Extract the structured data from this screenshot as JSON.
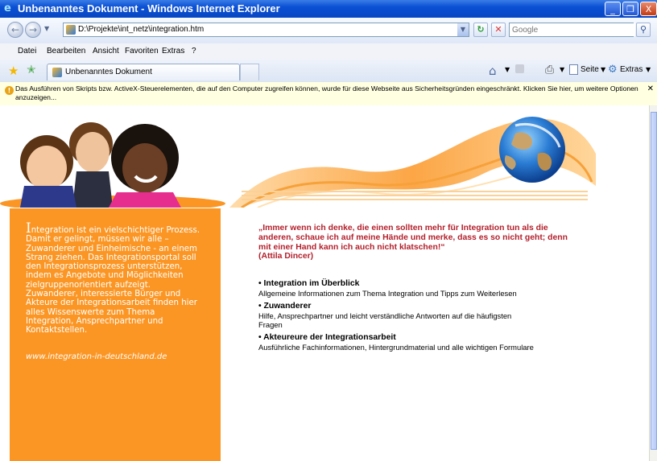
{
  "window": {
    "title": "Unbenanntes Dokument - Windows Internet Explorer",
    "minimize": "_",
    "maximize": "❐",
    "close": "X"
  },
  "address": {
    "url": "D:\\Projekte\\int_netz\\integration.htm",
    "search_placeholder": "Google"
  },
  "menu": {
    "items": [
      "Datei",
      "Bearbeiten",
      "Ansicht",
      "Favoriten",
      "Extras",
      "?"
    ]
  },
  "tabs": {
    "active_label": "Unbenanntes Dokument"
  },
  "commandbar": {
    "page_label": "Seite",
    "tools_label": "Extras"
  },
  "infobar": {
    "message": "Das Ausführen von Skripts bzw. ActiveX-Steuerelementen, die auf den Computer zugreifen können, wurde für diese Webseite aus Sicherheitsgründen eingeschränkt. Klicken Sie hier, um weitere Optionen anzuzeigen..."
  },
  "page": {
    "intro_initial": "I",
    "intro_text": "ntegration ist ein vielschichtiger Prozess. Damit er gelingt, müssen wir alle – Zuwanderer und Einheimische - an einem Strang ziehen. Das Integrationsportal soll den Integrationsprozess unterstützen, indem es Angebote und Möglichkeiten zielgruppenorientiert aufzeigt. Zuwanderer, interessierte Bürger und Akteure der Integrationsarbeit finden hier alles Wissenswerte zum Thema Integration, Ansprechpartner und Kontaktstellen.",
    "site_url": "www.integration-in-deutschland.de",
    "quote": "„Immer wenn ich denke, die einen sollten mehr für Integration tun als die anderen, schaue ich auf meine Hände und merke, dass es so nicht geht; denn mit einer Hand kann ich auch nicht klatschen!“",
    "quote_author": "(Attila Dincer)",
    "links": [
      {
        "title": "• Integration im Überblick",
        "desc": "Allgemeine Informationen zum Thema Integration und Tipps zum Weiterlesen"
      },
      {
        "title": "• Zuwanderer",
        "desc": "Hilfe, Ansprechpartner und leicht verständliche Antworten auf die häufigsten Fragen"
      },
      {
        "title": "• Akteureure der Integrationsarbeit",
        "desc": "Ausführliche Fachinformationen, Hintergrundmaterial und alle wichtigen Formulare"
      }
    ]
  },
  "colors": {
    "orange": "#fb9625",
    "quote_red": "#b3202c",
    "xp_blue": "#0a4fd4"
  }
}
